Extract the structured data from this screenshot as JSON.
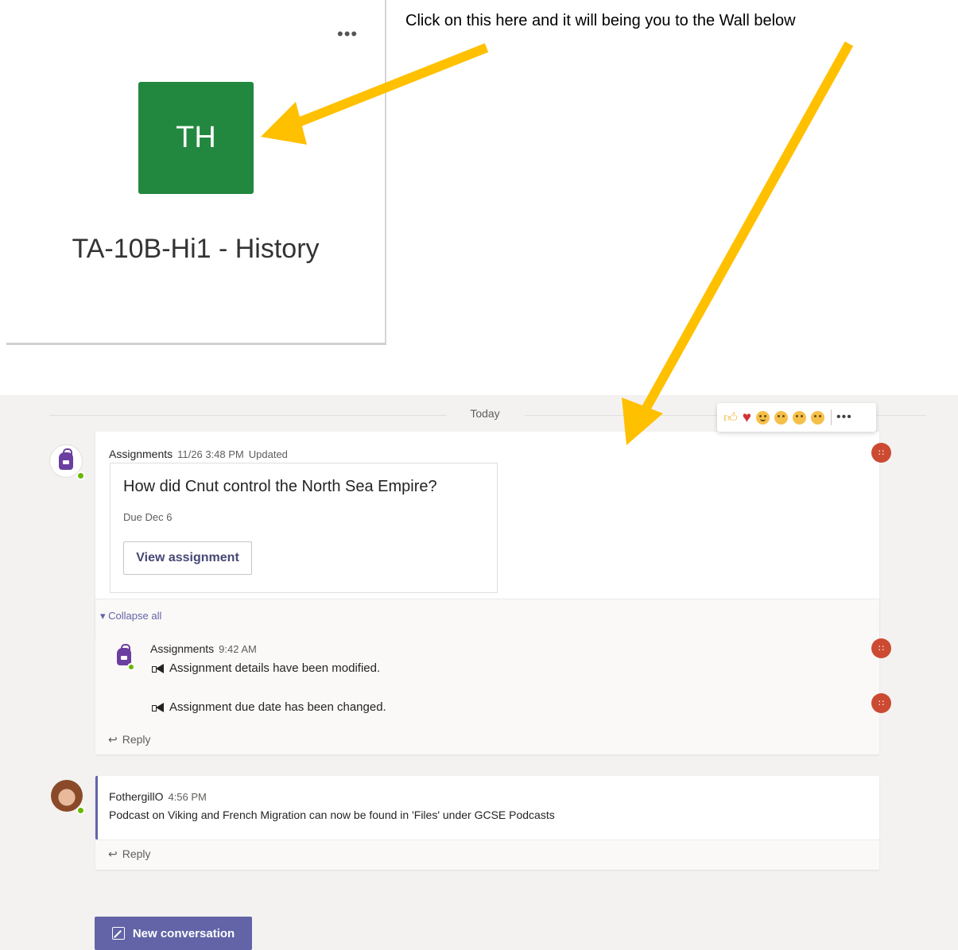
{
  "instruction": "Click on this here and it will being you to the Wall below",
  "team": {
    "more": "•••",
    "initials": "TH",
    "name": "TA-10B-Hi1 - History"
  },
  "wall": {
    "date_divider": "Today",
    "reactions": [
      "like",
      "heart",
      "laugh",
      "surprised",
      "sad",
      "angry"
    ],
    "reactions_more": "•••",
    "post1": {
      "author": "Assignments",
      "time": "11/26 3:48 PM",
      "status": "Updated",
      "assignment_title": "How did Cnut control the North Sea Empire?",
      "due": "Due Dec 6",
      "view_button": "View assignment"
    },
    "collapse": "Collapse all",
    "reply1": {
      "author": "Assignments",
      "time": "9:42 AM",
      "line1": "Assignment details have been modified.",
      "line2": "Assignment due date has been changed."
    },
    "reply_label": "Reply",
    "post2": {
      "author": "FothergillO",
      "time": "4:56 PM",
      "text": "Podcast on Viking and French Migration can now be found in 'Files' under GCSE Podcasts"
    },
    "new_conversation": "New conversation",
    "colors": {
      "accent": "#6264a7",
      "team_tile": "#22883f",
      "arrow": "#ffc000",
      "team_badge": "#cc4a31"
    }
  }
}
